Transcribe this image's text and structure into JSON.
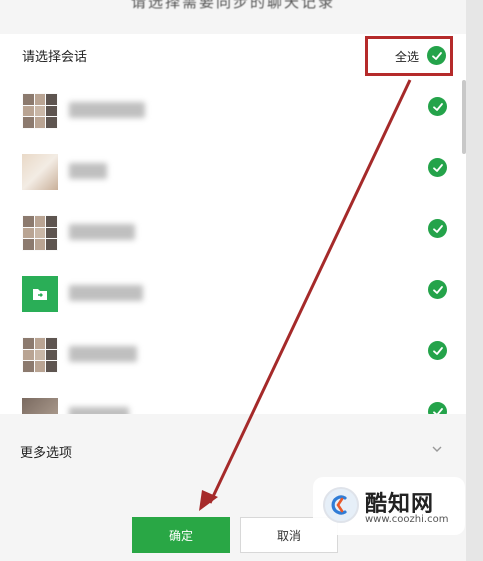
{
  "dialog": {
    "title": "请选择需要同步的聊天记录",
    "header_label": "请选择会话",
    "select_all_label": "全选"
  },
  "list": {
    "rows": [
      {
        "avatar": "group-grid-avatar",
        "checked": true
      },
      {
        "avatar": "photo-avatar",
        "checked": true
      },
      {
        "avatar": "group-grid-avatar",
        "checked": true
      },
      {
        "avatar": "folder-avatar",
        "checked": true
      },
      {
        "avatar": "group-grid-avatar",
        "checked": true
      },
      {
        "avatar": "photo-avatar",
        "checked": true
      }
    ]
  },
  "more_options": {
    "label": "更多选项",
    "icon": "chevron-down-icon"
  },
  "buttons": {
    "confirm_label": "确定",
    "cancel_label": "取消"
  },
  "watermark": {
    "title": "酷知网",
    "url": "www.coozhi.com"
  },
  "colors": {
    "accent_green": "#29a745",
    "check_green": "#24a34a",
    "highlight_red": "#b52a2a"
  }
}
